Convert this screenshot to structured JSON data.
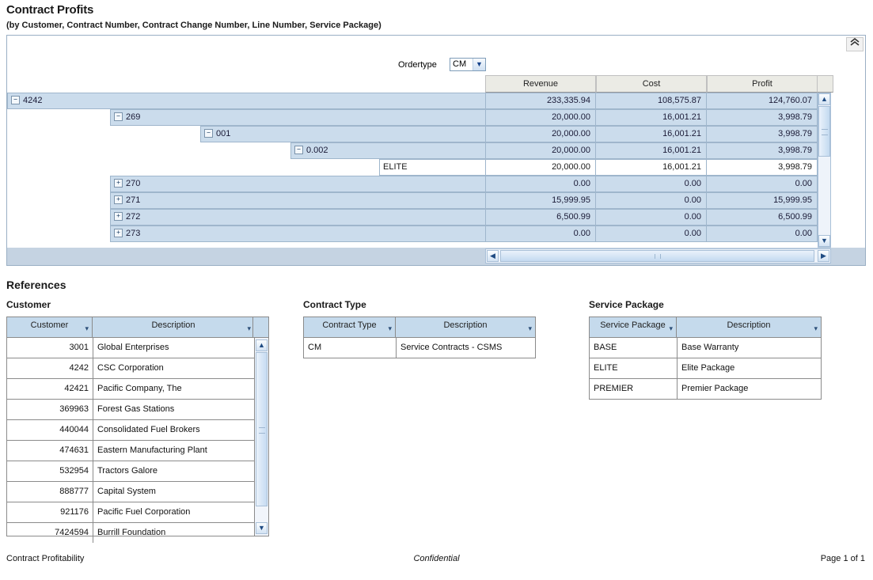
{
  "report": {
    "title": "Contract Profits",
    "subtitle": "(by Customer, Contract Number, Contract Change Number, Line Number, Service Package)",
    "collapse_icon": "chevron-double-up-icon"
  },
  "filters": {
    "ordertype_label": "Ordertype",
    "ordertype_value": "CM",
    "ordertype_arrow_icon": "chevron-down-icon"
  },
  "pivot": {
    "columns": [
      "Revenue",
      "Cost",
      "Profit"
    ],
    "rows": [
      {
        "level": 0,
        "expander": "minus",
        "label": "4242",
        "revenue": "233,335.94",
        "cost": "108,575.87",
        "profit": "124,760.07",
        "leaf": false
      },
      {
        "level": 1,
        "expander": "minus",
        "label": "269",
        "revenue": "20,000.00",
        "cost": "16,001.21",
        "profit": "3,998.79",
        "leaf": false
      },
      {
        "level": 2,
        "expander": "minus",
        "label": "001",
        "revenue": "20,000.00",
        "cost": "16,001.21",
        "profit": "3,998.79",
        "leaf": false
      },
      {
        "level": 3,
        "expander": "minus",
        "label": "0.002",
        "revenue": "20,000.00",
        "cost": "16,001.21",
        "profit": "3,998.79",
        "leaf": false
      },
      {
        "level": 4,
        "expander": "",
        "label": "ELITE",
        "revenue": "20,000.00",
        "cost": "16,001.21",
        "profit": "3,998.79",
        "leaf": true
      },
      {
        "level": 1,
        "expander": "plus",
        "label": "270",
        "revenue": "0.00",
        "cost": "0.00",
        "profit": "0.00",
        "leaf": false
      },
      {
        "level": 1,
        "expander": "plus",
        "label": "271",
        "revenue": "15,999.95",
        "cost": "0.00",
        "profit": "15,999.95",
        "leaf": false
      },
      {
        "level": 1,
        "expander": "plus",
        "label": "272",
        "revenue": "6,500.99",
        "cost": "0.00",
        "profit": "6,500.99",
        "leaf": false
      },
      {
        "level": 1,
        "expander": "plus",
        "label": "273",
        "revenue": "0.00",
        "cost": "0.00",
        "profit": "0.00",
        "leaf": false
      }
    ],
    "vscroll": {
      "up_icon": "chevron-up-icon",
      "down_icon": "chevron-down-icon"
    },
    "hscroll": {
      "left_icon": "chevron-left-icon",
      "right_icon": "chevron-right-icon"
    }
  },
  "references": {
    "heading": "References",
    "customer": {
      "title": "Customer",
      "headers": [
        "Customer",
        "Description"
      ],
      "sort_icon": "sort-descending-icon",
      "rows": [
        [
          "3001",
          "Global Enterprises"
        ],
        [
          "4242",
          "CSC Corporation"
        ],
        [
          "42421",
          "Pacific Company, The"
        ],
        [
          "369963",
          "Forest Gas Stations"
        ],
        [
          "440044",
          "Consolidated Fuel Brokers"
        ],
        [
          "474631",
          "Eastern Manufacturing Plant"
        ],
        [
          "532954",
          "Tractors Galore"
        ],
        [
          "888777",
          "Capital System"
        ],
        [
          "921176",
          "Pacific Fuel Corporation"
        ],
        [
          "7424594",
          "Burrill Foundation"
        ]
      ],
      "scroll": {
        "up_icon": "chevron-up-icon",
        "down_icon": "chevron-down-icon"
      }
    },
    "contract_type": {
      "title": "Contract Type",
      "headers": [
        "Contract Type",
        "Description"
      ],
      "sort_icon": "sort-descending-icon",
      "rows": [
        [
          "CM",
          "Service Contracts - CSMS"
        ]
      ]
    },
    "service_package": {
      "title": "Service Package",
      "headers": [
        "Service Package",
        "Description"
      ],
      "sort_icon": "sort-descending-icon",
      "rows": [
        [
          "BASE",
          "Base Warranty"
        ],
        [
          "ELITE",
          "Elite Package"
        ],
        [
          "PREMIER",
          "Premier Package"
        ]
      ]
    }
  },
  "footer": {
    "left": "Contract Profitability",
    "center": "Confidential",
    "right": "Page 1 of 1"
  }
}
